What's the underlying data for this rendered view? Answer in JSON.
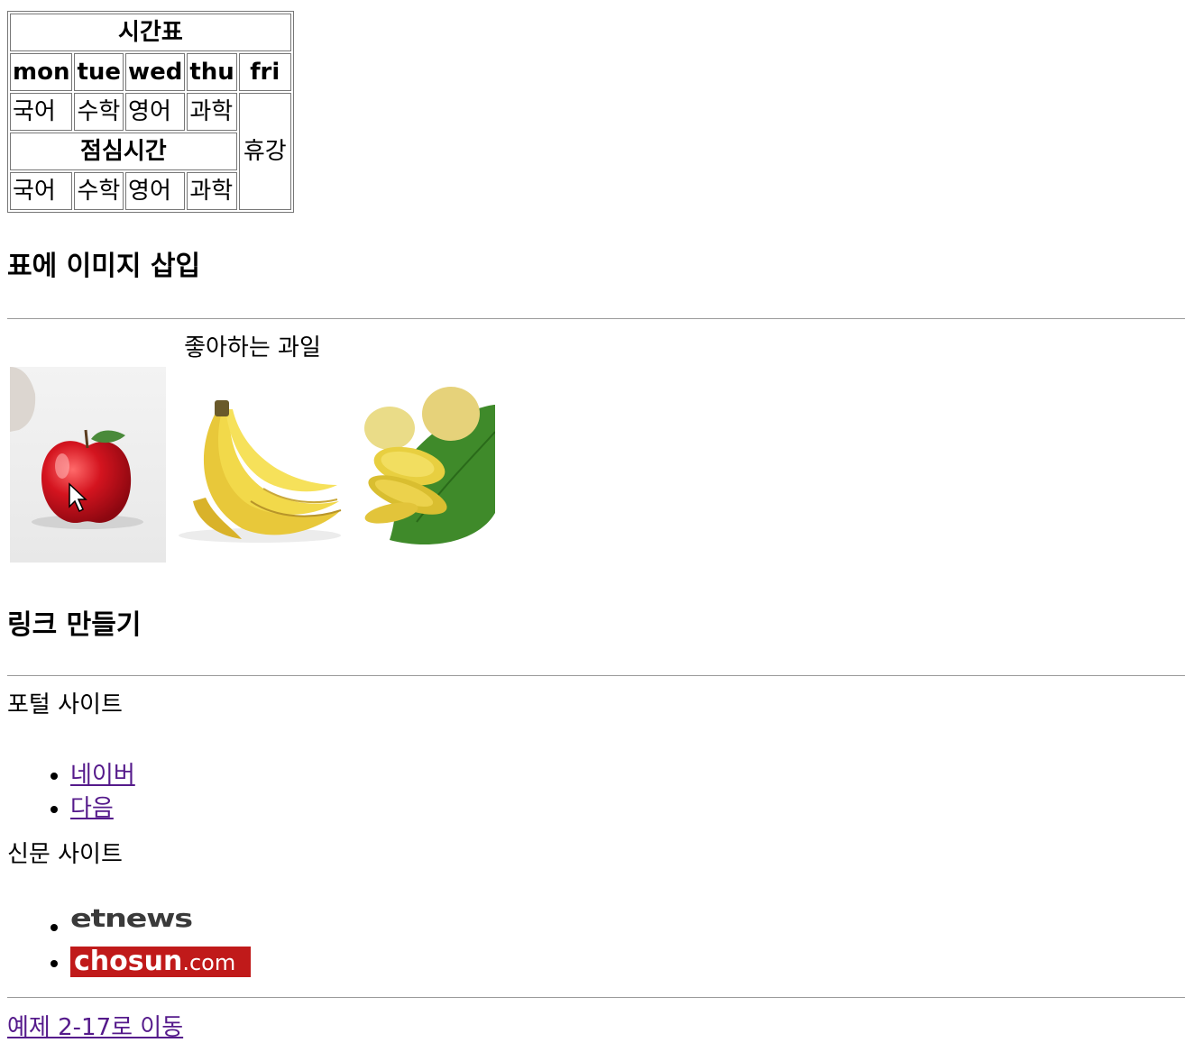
{
  "timetable": {
    "title": "시간표",
    "days": [
      "mon",
      "tue",
      "wed",
      "thu",
      "fri"
    ],
    "morning": [
      "국어",
      "수학",
      "영어",
      "과학"
    ],
    "lunch": "점심시간",
    "afternoon": [
      "국어",
      "수학",
      "영어",
      "과학"
    ],
    "friday": "휴강"
  },
  "image_section": {
    "heading": "표에 이미지 삽입",
    "caption": "좋아하는 과일",
    "images": [
      {
        "name": "apple",
        "icon": "apple-image"
      },
      {
        "name": "banana",
        "icon": "banana-image"
      },
      {
        "name": "mango",
        "icon": "mango-image"
      }
    ]
  },
  "link_section": {
    "heading": "링크 만들기",
    "portal_label": "포털 사이트",
    "portal_links": [
      "네이버",
      "다음"
    ],
    "news_label": "신문 사이트",
    "news_logos": {
      "etnews": "etnews",
      "chosun_main": "chosun",
      "chosun_suffix": ".com"
    },
    "bottom_link": "예제 2-17로 이동"
  },
  "colors": {
    "link": "#551a8b",
    "chosun_bg": "#c01a1a",
    "rule": "#9a9a9a"
  }
}
